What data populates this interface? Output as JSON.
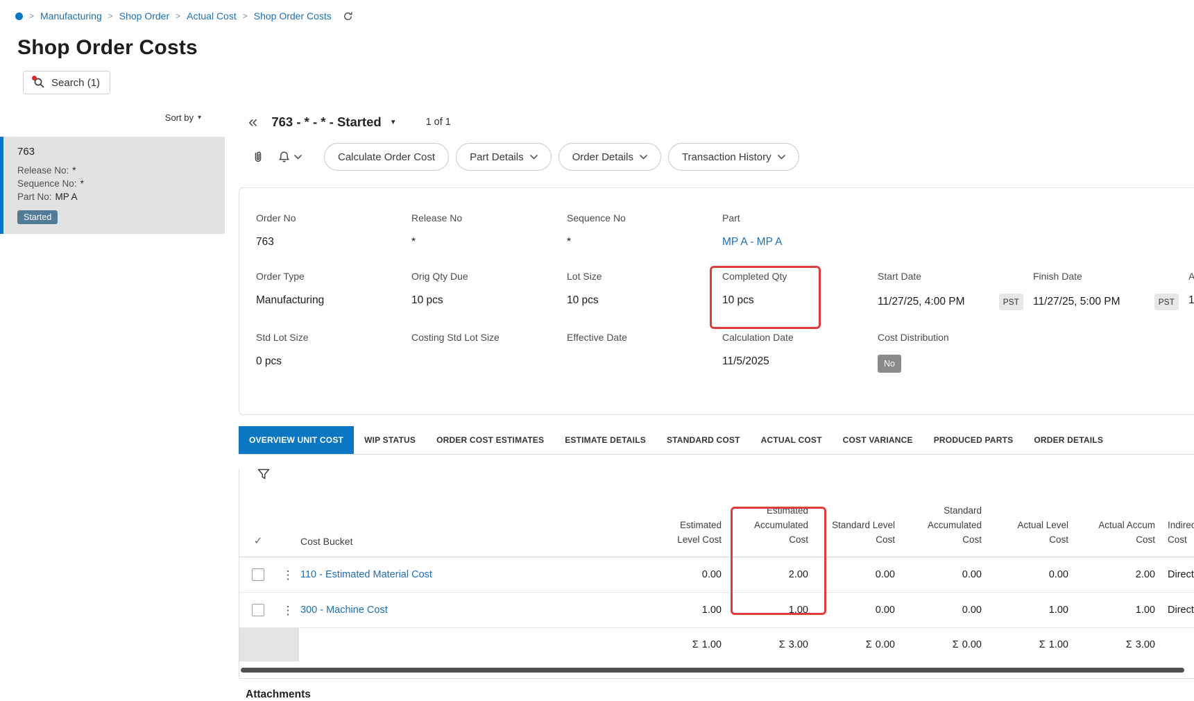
{
  "colors": {
    "accent": "#0b76c2",
    "link": "#1b6fb4",
    "annotation": "#e13c3c",
    "badge_started": "#527a99",
    "badge_neutral": "#8a8a8a",
    "chip_bg": "#e7e7e7"
  },
  "icons": {
    "breadcrumb_separator": ">",
    "collapse": "«",
    "title_caret": "▼",
    "sort_caret": "▾",
    "kebab": "⋮",
    "select_all": "✓"
  },
  "breadcrumb": {
    "items": [
      "Manufacturing",
      "Shop Order",
      "Actual Cost",
      "Shop Order Costs"
    ]
  },
  "page": {
    "title": "Shop Order Costs",
    "search_label": "Search (1)"
  },
  "sidebar": {
    "sort_by_label": "Sort by",
    "item": {
      "id": "763",
      "fields": [
        {
          "label": "Release No:",
          "value": "*"
        },
        {
          "label": "Sequence No:",
          "value": "*"
        },
        {
          "label": "Part No:",
          "value": "MP A"
        }
      ],
      "status": "Started"
    }
  },
  "record": {
    "title": "763 - * - * - Started",
    "pagination": "1 of 1"
  },
  "toolbar": {
    "buttons": [
      {
        "label": "Calculate Order Cost"
      },
      {
        "label": "Part Details"
      },
      {
        "label": "Order Details"
      },
      {
        "label": "Transaction History"
      }
    ]
  },
  "details": {
    "rows": [
      [
        {
          "label": "Order No",
          "value": "763"
        },
        {
          "label": "Release No",
          "value": "*"
        },
        {
          "label": "Sequence No",
          "value": "*"
        },
        {
          "label": "Part",
          "value": "MP A - MP A"
        }
      ],
      [
        {
          "label": "Order Type",
          "value": "Manufacturing"
        },
        {
          "label": "Orig Qty Due",
          "value": "10 pcs"
        },
        {
          "label": "Lot Size",
          "value": "10 pcs"
        },
        {
          "label": "Completed Qty",
          "value": "10 pcs"
        },
        {
          "label": "Start Date",
          "value": "11/27/25, 4:00 PM",
          "badge": "PST"
        },
        {
          "label": "Finish Date",
          "value": "11/27/25, 5:00 PM",
          "badge": "PST"
        },
        {
          "label": "A",
          "value": "1"
        }
      ],
      [
        {
          "label": "Std Lot Size",
          "value": "0 pcs"
        },
        {
          "label": "Costing Std Lot Size",
          "value": ""
        },
        {
          "label": "Effective Date",
          "value": ""
        },
        {
          "label": "Calculation Date",
          "value": "11/5/2025"
        },
        {
          "label": "Cost Distribution",
          "value": "No"
        }
      ]
    ]
  },
  "tabs": [
    "OVERVIEW UNIT COST",
    "WIP STATUS",
    "ORDER COST ESTIMATES",
    "ESTIMATE DETAILS",
    "STANDARD COST",
    "ACTUAL COST",
    "COST VARIANCE",
    "PRODUCED PARTS",
    "ORDER DETAILS"
  ],
  "table": {
    "bucket_header": "Cost Bucket",
    "numeric_headers": [
      [
        "Estimated",
        "Level Cost"
      ],
      [
        "Estimated",
        "Accumulated",
        "Cost"
      ],
      [
        "Standard Level",
        "Cost"
      ],
      [
        "Standard",
        "Accumulated",
        "Cost"
      ],
      [
        "Actual Level",
        "Cost"
      ],
      [
        "Actual Accum",
        "Cost"
      ]
    ],
    "indirect_header": [
      "Indirect",
      "Cost"
    ],
    "rows": [
      {
        "bucket": "110 - Estimated Material Cost",
        "values": [
          "0.00",
          "2.00",
          "0.00",
          "0.00",
          "0.00",
          "2.00"
        ],
        "indirect": "Direct"
      },
      {
        "bucket": "300 - Machine Cost",
        "values": [
          "1.00",
          "1.00",
          "0.00",
          "0.00",
          "1.00",
          "1.00"
        ],
        "indirect": "Direct"
      }
    ],
    "totals": {
      "sigma": "Σ",
      "values": [
        "1.00",
        "3.00",
        "0.00",
        "0.00",
        "1.00",
        "3.00"
      ]
    }
  },
  "attachments": {
    "title": "Attachments"
  }
}
